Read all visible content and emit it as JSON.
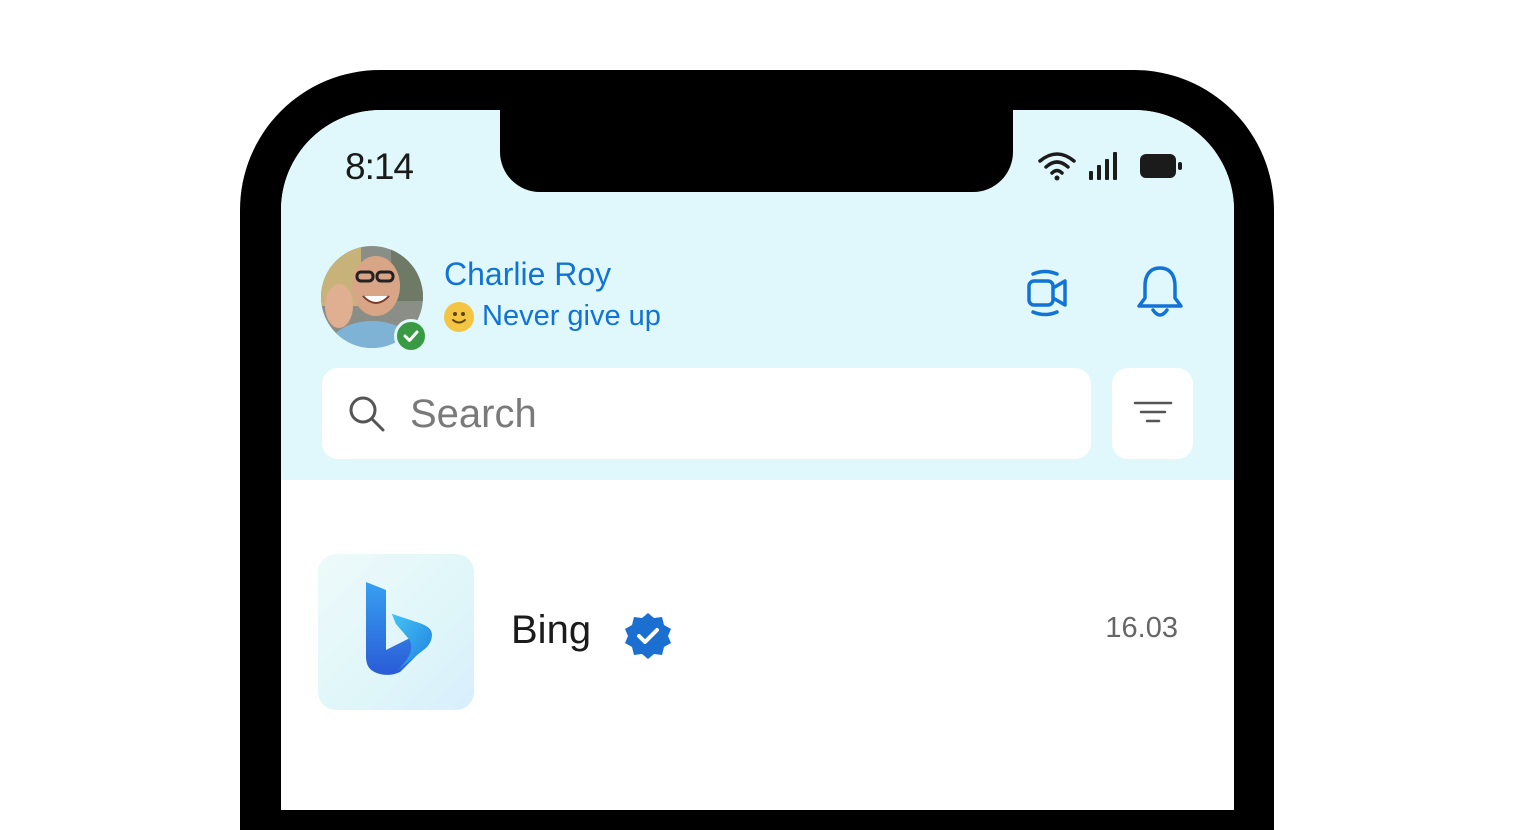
{
  "status_bar": {
    "time": "8:14"
  },
  "header": {
    "user_name": "Charlie Roy",
    "mood_message": "Never give up",
    "presence": "online"
  },
  "search": {
    "placeholder": "Search"
  },
  "chats": [
    {
      "name": "Bing",
      "verified": true,
      "time": "16.03",
      "icon": "bing-logo"
    }
  ],
  "colors": {
    "header_bg": "#e0f8fb",
    "accent": "#1273d6",
    "presence_green": "#3a9a44",
    "verified_blue": "#1a6fd1"
  }
}
